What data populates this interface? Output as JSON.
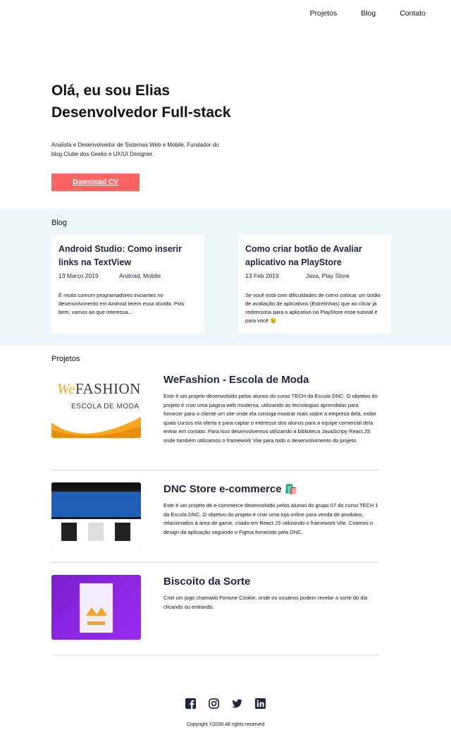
{
  "nav": {
    "items": [
      "Projetos",
      "Blog",
      "Contato"
    ]
  },
  "hero": {
    "title_line1": "Olá, eu sou Elias",
    "title_line2": "Desenvolvedor Full-stack",
    "description": "Analista e Desenvolvedor de Sistemas Web e Mobile, Fundador do blog Clube dos Geeks e UX/UI Designer.",
    "cta_label": "Download CV"
  },
  "blog": {
    "title": "Blog",
    "posts": [
      {
        "title": "Android Studio: Como inserir links na TextView",
        "date": "13 Março 2019",
        "tags": "Android, Mobile",
        "excerpt": "É muito comum programadores iniciantes no desenvolvimento em Android terem essa dúvida. Pois bem, vamos ao que interessa..."
      },
      {
        "title": "Como criar botão de Avaliar aplicativo na PlayStore",
        "date": "13 Feb 2019",
        "tags": "Java, Play Store",
        "excerpt": "Se você está com dificuldades de como colocar um botão de avaliação de aplicativos (Estrelinhas) que ao clicar já redireciona para o aplicativo na PlayStore esse tutorial é para você 😉"
      }
    ]
  },
  "projects": {
    "title": "Projetos",
    "items": [
      {
        "title": "WeFashion - Escola de Moda",
        "description": "Este é um projeto desenvolvido pelos alunos do curso TECH da Escola DNC. O objetivo do projeto é criar uma página web moderna, utilizando as tecnologias aprendidas para fornecer para o cliente um site onde ela consiga mostrar mais sobre a empresa dela, exibir quais cursos ela oferta e para captar o interesse dos alunos para a equipe comercial dela entrar em contato. Para isso desenvolvemos utilizando a biblioteca JavaScripy React.JS onde também utilizamos o framework Vite para todo o desenvolvimento do projeto.",
        "thumb_text": "WeFASHION",
        "thumb_text_accent": "We",
        "thumb_text_rest": "FASHION",
        "thumb_sub": "ESCOLA DE MODA"
      },
      {
        "title": "DNC Store e-commerce 🛍️",
        "description": "Este é um projeto de e-commerce desenvolvido pelos alunos do grupo 07 do curso TECH 1 da Escola DNC. O objetivo do projeto é criar uma loja online para venda de produtos, relacionados à área de game, criado em React.JS utilizando o framework Vite. Criamos o design da aplicação seguindo o Figma fornecido pela DNC."
      },
      {
        "title": "Biscoito da Sorte",
        "description": "Criei um jogo chamado Fortune Cookie, onde os usuários podem revelar a sorte do dia clicando ou entrando."
      }
    ]
  },
  "footer": {
    "icons": [
      "facebook-icon",
      "instagram-icon",
      "twitter-icon",
      "linkedin-icon"
    ],
    "copyright": "Copyright ©2030 All rights reserved"
  },
  "colors": {
    "accent": "#ff6464",
    "blog_bg": "#edf7fa",
    "heading": "#21243d"
  }
}
